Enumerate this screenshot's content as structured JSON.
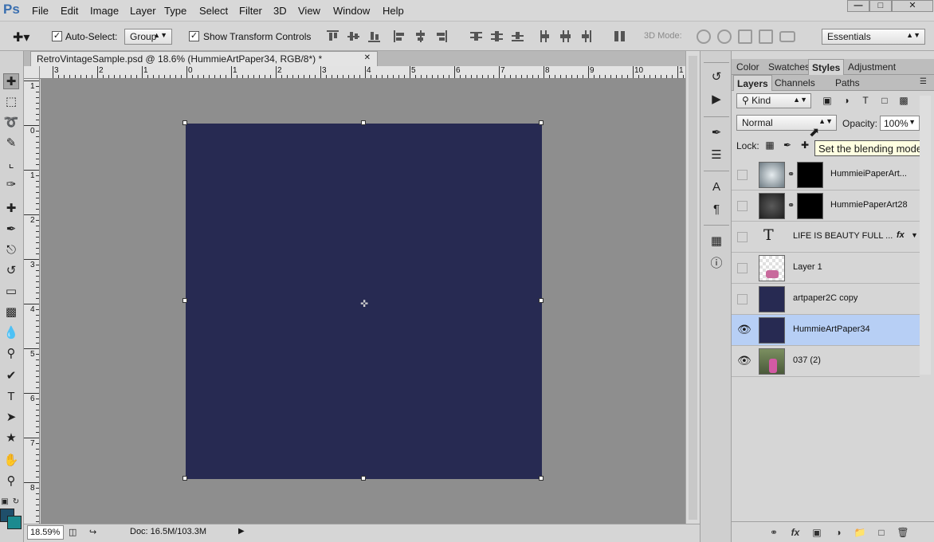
{
  "app": {
    "logo": "Ps",
    "menus": [
      "File",
      "Edit",
      "Image",
      "Layer",
      "Type",
      "Select",
      "Filter",
      "3D",
      "View",
      "Window",
      "Help"
    ],
    "window_buttons": [
      "—",
      "□",
      "✕"
    ]
  },
  "options_bar": {
    "auto_select_label": "Auto-Select:",
    "auto_select_value": "Group",
    "show_transform_label": "Show Transform Controls",
    "mode_3d_label": "3D Mode:",
    "workspace": "Essentials"
  },
  "document": {
    "tab_title": "RetroVintageSample.psd @ 18.6% (HummieArtPaper34, RGB/8*) *",
    "fill_color": "#272a52"
  },
  "ruler": {
    "top_labels": [
      "3",
      "2",
      "1",
      "0",
      "1",
      "2",
      "3",
      "4",
      "5",
      "6",
      "7",
      "8",
      "9",
      "10",
      "1"
    ],
    "left_labels": [
      "1",
      "0",
      "1",
      "2",
      "3",
      "4",
      "5",
      "6",
      "7",
      "8"
    ]
  },
  "status": {
    "zoom": "18.59%",
    "doc_size": "Doc: 16.5M/103.3M"
  },
  "panels": {
    "top_tabs": [
      "Color",
      "Swatches",
      "Styles",
      "Adjustment"
    ],
    "layer_tabs": [
      "Layers",
      "Channels",
      "Paths"
    ],
    "kind": "Kind",
    "blend_mode": "Normal",
    "opacity_label": "Opacity:",
    "opacity_value": "100%",
    "lock_label": "Lock:",
    "tooltip": "Set the blending mode"
  },
  "layers": [
    {
      "name": "HummieiPaperArt...",
      "visible": false,
      "thumb": "paper-light",
      "mask": true
    },
    {
      "name": "HummiePaperArt28",
      "visible": false,
      "thumb": "paper-dark",
      "mask": true
    },
    {
      "name": "LIFE  IS BEAUTY FULL ...",
      "visible": false,
      "thumb": "type",
      "fx": "fx"
    },
    {
      "name": "Layer 1",
      "visible": false,
      "thumb": "checker"
    },
    {
      "name": "artpaper2C copy",
      "visible": false,
      "thumb": "navy"
    },
    {
      "name": "HummieArtPaper34",
      "visible": true,
      "thumb": "navy",
      "selected": true
    },
    {
      "name": "037 (2)",
      "visible": true,
      "thumb": "photo"
    }
  ],
  "colors": {
    "foreground": "#1f4f6b",
    "background": "#1b8a8f",
    "selection": "#b7cff5"
  },
  "icons": [
    "move-icon",
    "marquee-icon",
    "lasso-icon",
    "quick-select-icon",
    "crop-icon",
    "eyedropper-icon",
    "healing-icon",
    "brush-icon",
    "stamp-icon",
    "history-brush-icon",
    "eraser-icon",
    "gradient-icon",
    "blur-icon",
    "dodge-icon",
    "pen-icon",
    "type-icon",
    "path-select-icon",
    "shape-icon",
    "hand-icon",
    "zoom-icon"
  ]
}
